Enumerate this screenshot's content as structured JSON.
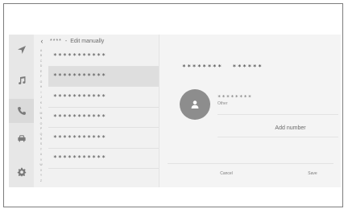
{
  "header": {
    "back_icon": "chevron-left-icon",
    "masked_name": "****",
    "separator": "-",
    "title": "Edit manually"
  },
  "rail": {
    "items": [
      {
        "icon": "navigation-arrow-icon",
        "active": false
      },
      {
        "icon": "music-note-icon",
        "active": false
      },
      {
        "icon": "phone-icon",
        "active": true
      },
      {
        "icon": "car-icon",
        "active": false
      },
      {
        "icon": "gear-icon",
        "active": false
      }
    ]
  },
  "index_letters": [
    "A",
    "B",
    "C",
    "D",
    "E",
    "F",
    "G",
    "H",
    "I",
    "J",
    "K",
    "L",
    "M",
    "N",
    "O",
    "P",
    "Q",
    "R",
    "S",
    "T",
    "U",
    "V",
    "W",
    "X",
    "Y",
    "Z"
  ],
  "contacts": {
    "items": [
      {
        "name": "***********",
        "selected": false
      },
      {
        "name": "***********",
        "selected": true
      },
      {
        "name": "***********",
        "selected": false
      },
      {
        "name": "***********",
        "selected": false
      },
      {
        "name": "***********",
        "selected": false
      },
      {
        "name": "***********",
        "selected": false
      }
    ]
  },
  "detail": {
    "first_name": "********",
    "last_name": "******",
    "avatar_icon": "person-icon",
    "phone_number": "********",
    "phone_type": "Other",
    "add_number_label": "Add number",
    "cancel_label": "Cancel",
    "save_label": "Save"
  },
  "colors": {
    "screen_bg": "#f1f1f1",
    "rail_bg": "#e7e7e7",
    "selected_row": "#dedede",
    "avatar_bg": "#8d8d8d",
    "icon": "#7a7a7a"
  }
}
